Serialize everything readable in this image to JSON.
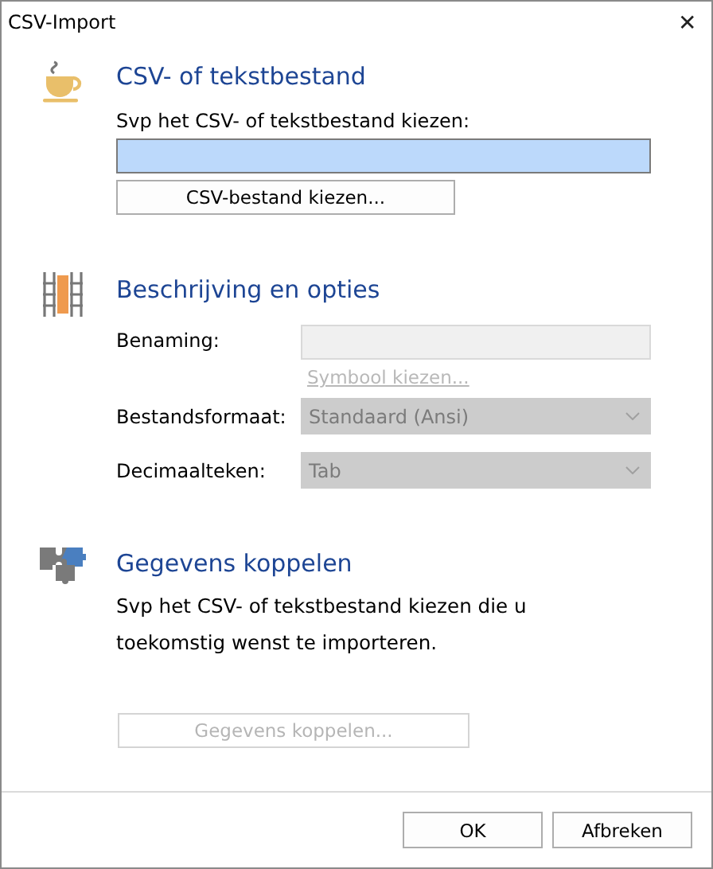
{
  "window": {
    "title": "CSV-Import",
    "close": "✕"
  },
  "file_section": {
    "heading": "CSV- of tekstbestand",
    "label": "Svp het CSV- of tekstbestand kiezen:",
    "field": {
      "focused": true
    },
    "button": {
      "label": "CSV-bestand kiezen...",
      "disabled": false
    }
  },
  "options_section": {
    "heading": "Beschrijving en opties",
    "name_field": {
      "label": "Benaming:",
      "disabled": true
    },
    "symbol_link": {
      "label": "Symbool kiezen...",
      "disabled": true
    },
    "dropdowns": [
      {
        "label": "Bestandsformaat:",
        "value": "Standaard (Ansi)",
        "disabled": true
      },
      {
        "label": "Decimaalteken:",
        "value": "Tab",
        "disabled": true
      }
    ]
  },
  "link_section": {
    "heading": "Gegevens koppelen",
    "text": "Svp het CSV- of tekstbestand kiezen die u toekomstig wenst te importeren.",
    "button": {
      "label": "Gegevens koppelen...",
      "disabled": true
    }
  },
  "buttons": [
    {
      "label": "OK",
      "disabled": false
    },
    {
      "label": "Afbreken",
      "disabled": false
    }
  ]
}
